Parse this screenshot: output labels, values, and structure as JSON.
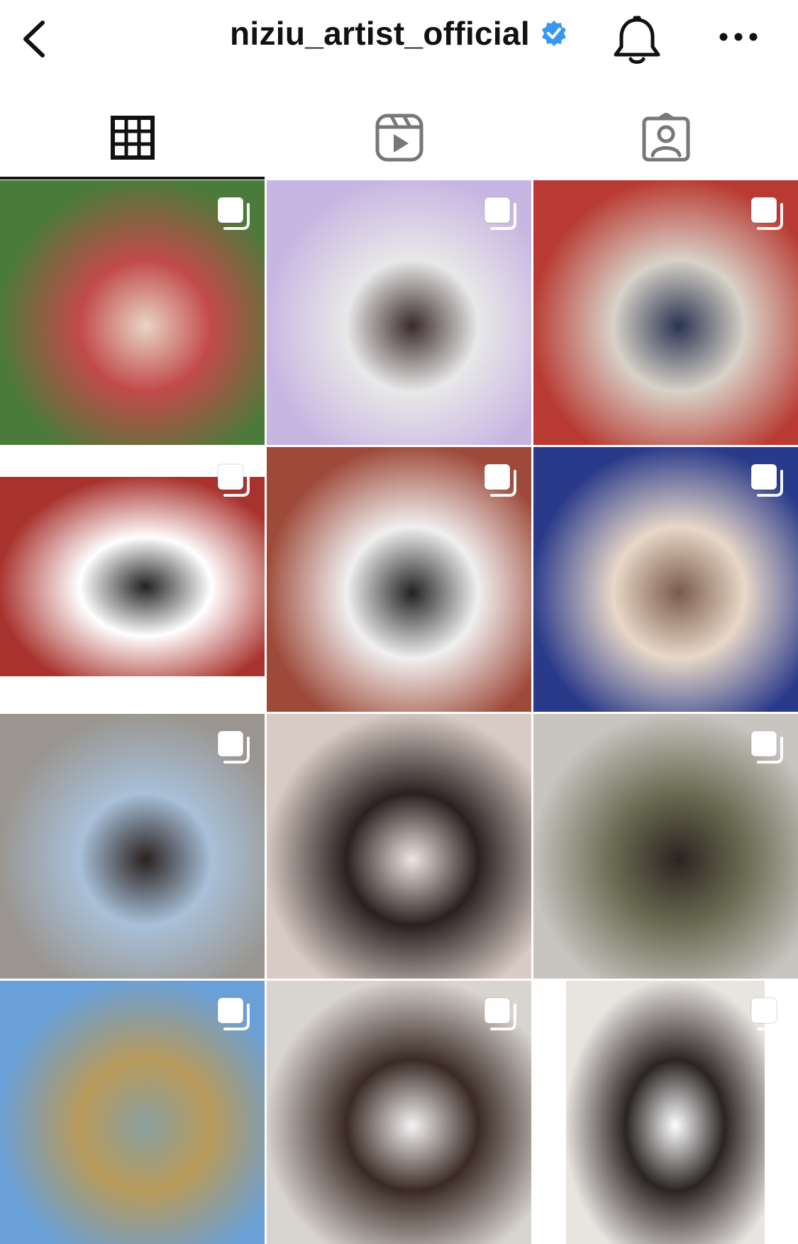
{
  "header": {
    "username": "niziu_artist_official",
    "verified": true,
    "icons": [
      "back-chevron-icon",
      "verified-badge-icon",
      "bell-icon",
      "more-icon"
    ],
    "accent_color": "#3897f0"
  },
  "tabs": [
    {
      "name": "posts-grid",
      "icon": "grid-icon",
      "active": true
    },
    {
      "name": "reels",
      "icon": "reels-icon",
      "active": false
    },
    {
      "name": "tagged",
      "icon": "tagged-user-icon",
      "active": false
    }
  ],
  "posts": [
    {
      "id": 1,
      "multiple": true,
      "icon": "multiple-photos-icon",
      "colors": [
        "#4a7b3a",
        "#c24a4a",
        "#e8d5c5"
      ]
    },
    {
      "id": 2,
      "multiple": true,
      "icon": "multiple-photos-icon",
      "colors": [
        "#c8b6e2",
        "#e8e8e8",
        "#3a2a2a"
      ]
    },
    {
      "id": 3,
      "multiple": true,
      "icon": "multiple-photos-icon",
      "colors": [
        "#b83a32",
        "#d8d2c8",
        "#2a3450"
      ]
    },
    {
      "id": 4,
      "multiple": true,
      "icon": "multiple-photos-icon",
      "colors": [
        "#a8322d",
        "#ffffff",
        "#222222"
      ]
    },
    {
      "id": 5,
      "multiple": true,
      "icon": "multiple-photos-icon",
      "colors": [
        "#9e4a3a",
        "#f0f0f0",
        "#222222"
      ]
    },
    {
      "id": 6,
      "multiple": true,
      "icon": "multiple-photos-icon",
      "colors": [
        "#2a3a8a",
        "#e8d8c8",
        "#7a5a4a"
      ]
    },
    {
      "id": 7,
      "multiple": true,
      "icon": "multiple-photos-icon",
      "colors": [
        "#9a9590",
        "#a8c0d8",
        "#2a2220"
      ]
    },
    {
      "id": 8,
      "multiple": false,
      "icon": "",
      "colors": [
        "#d8cbc4",
        "#2a2020",
        "#f0e6e0"
      ]
    },
    {
      "id": 9,
      "multiple": true,
      "icon": "multiple-photos-icon",
      "colors": [
        "#c8c4c0",
        "#6a6a52",
        "#2a2420"
      ]
    },
    {
      "id": 10,
      "multiple": true,
      "icon": "multiple-photos-icon",
      "colors": [
        "#6aa0d8",
        "#b89a5a",
        "#8aa0a0"
      ]
    },
    {
      "id": 11,
      "multiple": true,
      "icon": "multiple-photos-icon",
      "colors": [
        "#d8d4d0",
        "#3a2a24",
        "#f4f4f4"
      ]
    },
    {
      "id": 12,
      "multiple": true,
      "icon": "multiple-photos-icon",
      "colors": [
        "#e8e4e0",
        "#2a2424",
        "#ffffff"
      ]
    }
  ]
}
